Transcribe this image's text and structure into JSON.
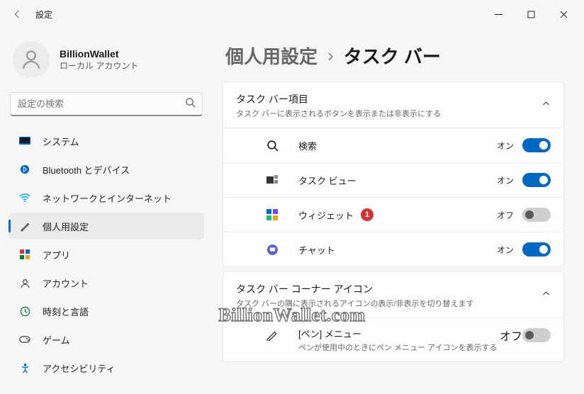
{
  "window": {
    "title": "設定"
  },
  "account": {
    "name": "BillionWallet",
    "type": "ローカル アカウント"
  },
  "search": {
    "placeholder": "設定の検索"
  },
  "sidebar": {
    "items": [
      {
        "label": "システム"
      },
      {
        "label": "Bluetooth とデバイス"
      },
      {
        "label": "ネットワークとインターネット"
      },
      {
        "label": "個人用設定"
      },
      {
        "label": "アプリ"
      },
      {
        "label": "アカウント"
      },
      {
        "label": "時刻と言語"
      },
      {
        "label": "ゲーム"
      },
      {
        "label": "アクセシビリティ"
      }
    ]
  },
  "breadcrumb": {
    "parent": "個人用設定",
    "current": "タスク バー"
  },
  "sections": {
    "taskbar_items": {
      "title": "タスク バー項目",
      "subtitle": "タスク バーに表示されるボタンを表示または非表示にする",
      "rows": [
        {
          "label": "検索",
          "state": "オン",
          "on": true
        },
        {
          "label": "タスク ビュー",
          "state": "オン",
          "on": true
        },
        {
          "label": "ウィジェット",
          "state": "オフ",
          "on": false,
          "badge": "1"
        },
        {
          "label": "チャット",
          "state": "オン",
          "on": true
        }
      ]
    },
    "corner_icons": {
      "title": "タスク バー コーナー アイコン",
      "subtitle": "タスク バーの隅に表示されるアイコンの表示/非表示を切り替えます",
      "rows": [
        {
          "label": "[ペン] メニュー",
          "sub": "ペンが使用中のときにペン メニュー アイコンを表示する",
          "state": "オフ",
          "on": false
        }
      ]
    }
  },
  "watermark": "BillionWallet.com"
}
